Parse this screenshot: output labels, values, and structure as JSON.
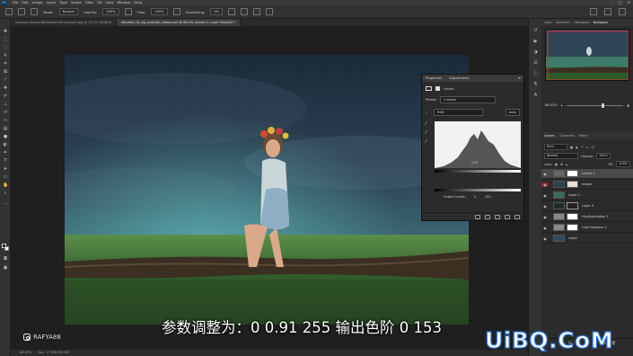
{
  "menubar": {
    "items": [
      "File",
      "Edit",
      "Image",
      "Layer",
      "Type",
      "Select",
      "Filter",
      "3D",
      "View",
      "Window",
      "Help"
    ]
  },
  "options": {
    "mode_label": "Mode:",
    "mode_value": "Normal",
    "opacity_label": "Opacity:",
    "opacity_value": "100%",
    "flow_label": "Flow:",
    "flow_value": "100%",
    "smoothing_label": "Smoothing:",
    "smoothing_value": "0%"
  },
  "tabs": [
    {
      "label": "vanessa-iinasio-WaXVkweXv8-unsplash.jpg @ 16.1% (RGB/8)",
      "active": false
    },
    {
      "label": "fairytale_01_bg_anatalia_elabas.psd @ 66.4% (Levels 1, Layer Mask/8) *",
      "active": true
    }
  ],
  "properties": {
    "tab_properties": "Properties",
    "tab_adjustments": "Adjustments",
    "adj_name": "Levels",
    "preset_label": "Preset:",
    "preset_value": "Custom",
    "channel_value": "RGB",
    "auto_label": "Auto",
    "input_black": "0",
    "input_gray": "0.91",
    "input_white": "255",
    "output_label": "Output Levels:",
    "output_black": "0",
    "output_white": "153"
  },
  "panel_tabs_top": [
    "Color",
    "Swatches",
    "Histogram",
    "Navigator"
  ],
  "navigator": {
    "zoom": "66.42%"
  },
  "layers": {
    "tabs": [
      "Layers",
      "Channels",
      "Paths"
    ],
    "kind_label": "Kind",
    "blend_mode": "Normal",
    "opacity_label": "Opacity:",
    "opacity_value": "100%",
    "lock_label": "Lock:",
    "fill_label": "Fill:",
    "fill_value": "100%",
    "items": [
      {
        "name": "Levels 1",
        "selected": true
      },
      {
        "name": "model",
        "selected": false
      },
      {
        "name": "Layer 1",
        "selected": false
      },
      {
        "name": "Layer 0",
        "selected": false
      },
      {
        "name": "Hue/Saturation 1",
        "selected": false
      },
      {
        "name": "Color Balance 1",
        "selected": false
      },
      {
        "name": "cloud",
        "selected": false
      }
    ]
  },
  "status": {
    "zoom": "66.42%",
    "doc": "Doc: 17.5M/190.4M"
  },
  "subtitle": "参数调整为：0 0.91 255  输出色阶 0 153",
  "watermark_left": "RAFYA88",
  "watermark_right": "UiBQ.CoM"
}
